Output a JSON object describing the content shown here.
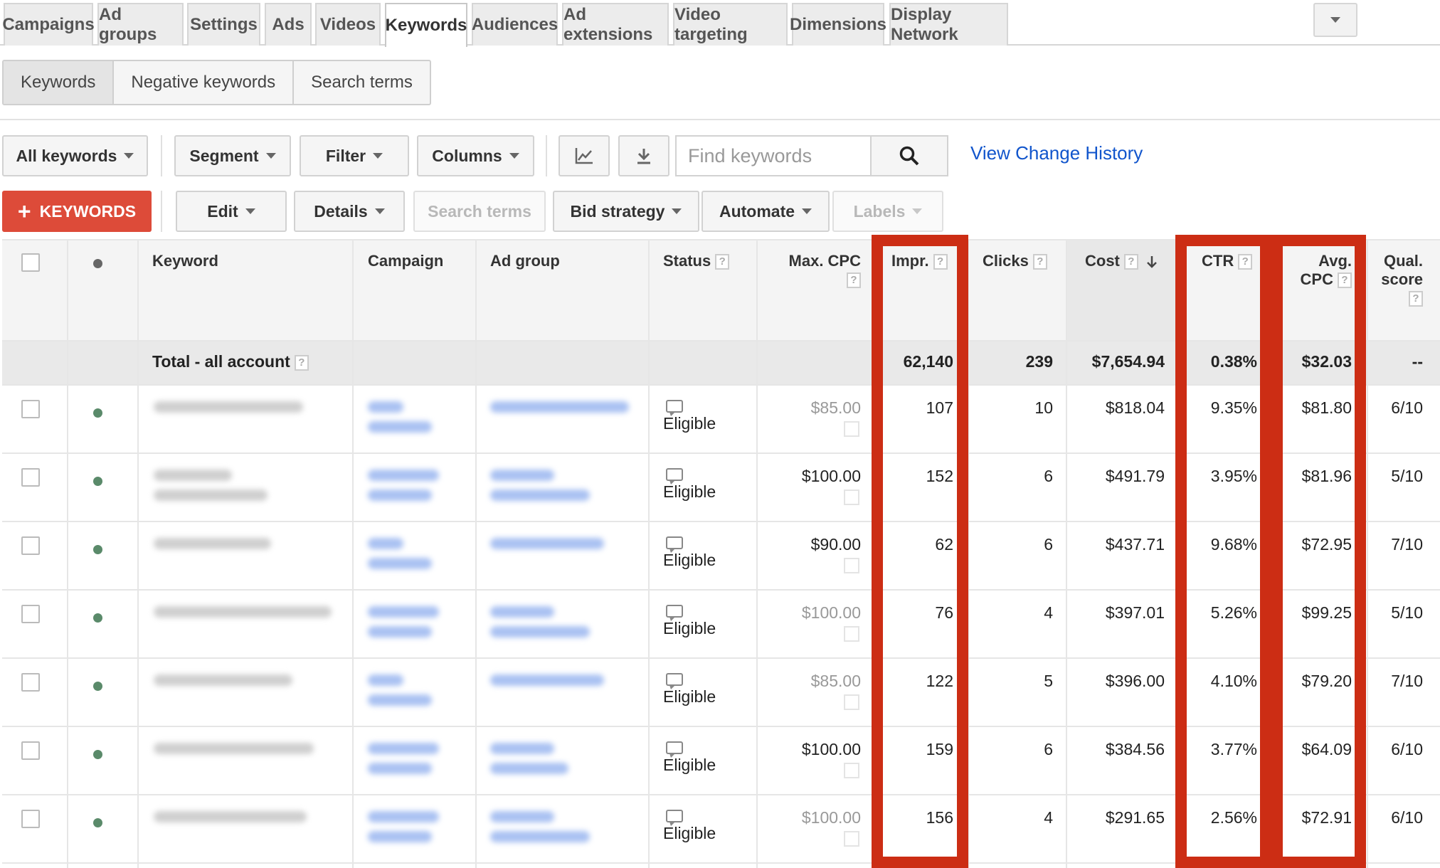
{
  "tabs": [
    "Campaigns",
    "Ad groups",
    "Settings",
    "Ads",
    "Videos",
    "Keywords",
    "Audiences",
    "Ad extensions",
    "Video targeting",
    "Dimensions",
    "Display Network"
  ],
  "active_tab": "Keywords",
  "subtabs": [
    "Keywords",
    "Negative keywords",
    "Search terms"
  ],
  "toolbar1": {
    "all_keywords": "All keywords",
    "segment": "Segment",
    "filter": "Filter",
    "columns": "Columns",
    "search_placeholder": "Find keywords",
    "change_history": "View Change History"
  },
  "toolbar2": {
    "add_keywords": "KEYWORDS",
    "edit": "Edit",
    "details": "Details",
    "search_terms": "Search terms",
    "bid_strategy": "Bid strategy",
    "automate": "Automate",
    "labels": "Labels"
  },
  "columns": {
    "keyword": "Keyword",
    "campaign": "Campaign",
    "ad_group": "Ad group",
    "status": "Status",
    "max_cpc": "Max. CPC",
    "impr": "Impr.",
    "clicks": "Clicks",
    "cost": "Cost",
    "ctr": "CTR",
    "avg_cpc_1": "Avg.",
    "avg_cpc_2": "CPC",
    "qual_1": "Qual.",
    "qual_2": "score"
  },
  "total": {
    "label": "Total - all account",
    "impr": "62,140",
    "clicks": "239",
    "cost": "$7,654.94",
    "ctr": "0.38%",
    "avg_cpc": "$32.03",
    "qual": "--"
  },
  "rows": [
    {
      "status": "Eligible",
      "max_cpc": "$85.00",
      "max_cpc_default": true,
      "impr": "107",
      "clicks": "10",
      "cost": "$818.04",
      "ctr": "9.35%",
      "avg_cpc": "$81.80",
      "qual": "6/10"
    },
    {
      "status": "Eligible",
      "max_cpc": "$100.00",
      "max_cpc_default": false,
      "impr": "152",
      "clicks": "6",
      "cost": "$491.79",
      "ctr": "3.95%",
      "avg_cpc": "$81.96",
      "qual": "5/10"
    },
    {
      "status": "Eligible",
      "max_cpc": "$90.00",
      "max_cpc_default": false,
      "impr": "62",
      "clicks": "6",
      "cost": "$437.71",
      "ctr": "9.68%",
      "avg_cpc": "$72.95",
      "qual": "7/10"
    },
    {
      "status": "Eligible",
      "max_cpc": "$100.00",
      "max_cpc_default": true,
      "impr": "76",
      "clicks": "4",
      "cost": "$397.01",
      "ctr": "5.26%",
      "avg_cpc": "$99.25",
      "qual": "5/10"
    },
    {
      "status": "Eligible",
      "max_cpc": "$85.00",
      "max_cpc_default": true,
      "impr": "122",
      "clicks": "5",
      "cost": "$396.00",
      "ctr": "4.10%",
      "avg_cpc": "$79.20",
      "qual": "7/10"
    },
    {
      "status": "Eligible",
      "max_cpc": "$100.00",
      "max_cpc_default": false,
      "impr": "159",
      "clicks": "6",
      "cost": "$384.56",
      "ctr": "3.77%",
      "avg_cpc": "$64.09",
      "qual": "6/10"
    },
    {
      "status": "Eligible",
      "max_cpc": "$100.00",
      "max_cpc_default": true,
      "impr": "156",
      "clicks": "4",
      "cost": "$291.65",
      "ctr": "2.56%",
      "avg_cpc": "$72.91",
      "qual": "6/10"
    }
  ],
  "colors": {
    "highlight": "#cc2d14",
    "accent_red": "#dd4b39",
    "link": "#1155cc"
  }
}
